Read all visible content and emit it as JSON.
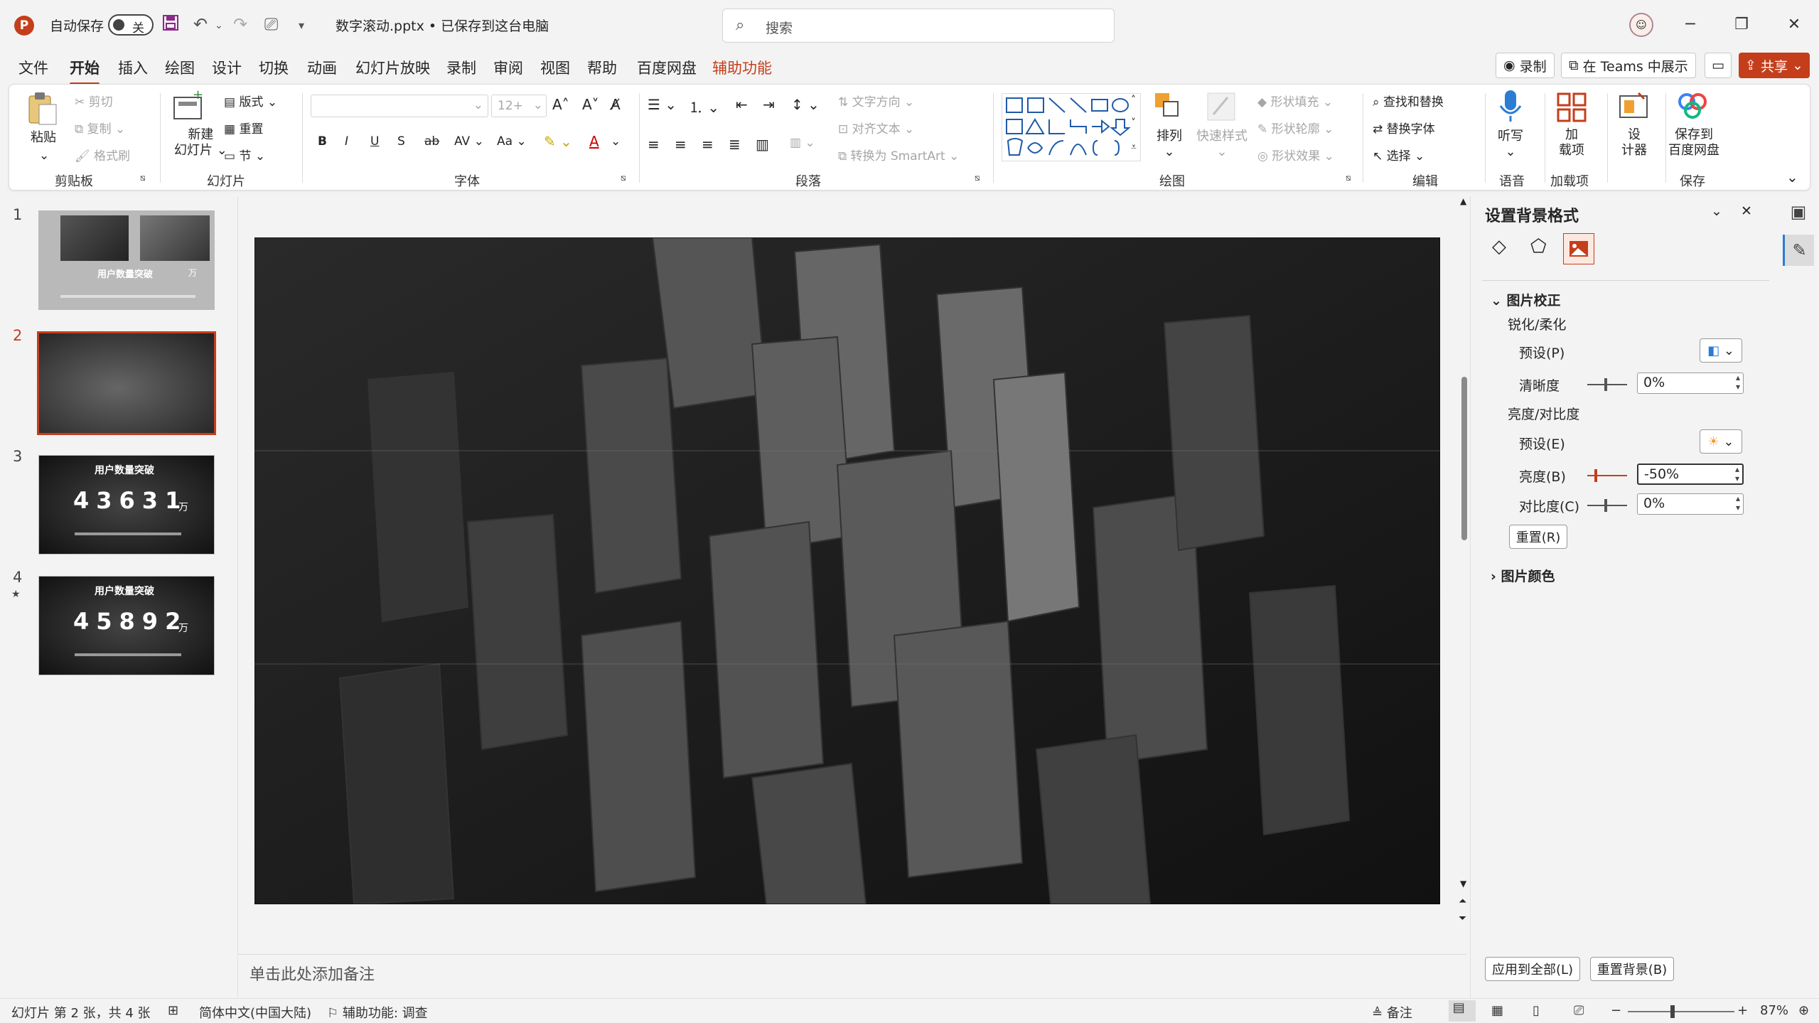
{
  "titlebar": {
    "autosave_label": "自动保存",
    "autosave_state": "关",
    "doc_title": "数字滚动.pptx • 已保存到这台电脑",
    "search_placeholder": "搜索",
    "logo": "P"
  },
  "menu": {
    "tabs": [
      "文件",
      "开始",
      "插入",
      "绘图",
      "设计",
      "切换",
      "动画",
      "幻灯片放映",
      "录制",
      "审阅",
      "视图",
      "帮助",
      "百度网盘",
      "辅助功能"
    ],
    "active": "开始",
    "record_label": "录制",
    "teams_label": "在 Teams 中展示",
    "share_label": "共享"
  },
  "ribbon": {
    "clipboard": {
      "paste": "粘贴",
      "cut": "剪切",
      "copy": "复制",
      "format_painter": "格式刷",
      "group": "剪贴板"
    },
    "slides": {
      "new_slide_line1": "新建",
      "new_slide_line2": "幻灯片",
      "layout": "版式",
      "reset": "重置",
      "section": "节",
      "group": "幻灯片"
    },
    "font": {
      "size": "12+",
      "group": "字体"
    },
    "paragraph": {
      "text_direction": "文字方向",
      "align_text": "对齐文本",
      "smartart": "转换为 SmartArt",
      "group": "段落"
    },
    "drawing": {
      "arrange": "排列",
      "quick_styles": "快速样式",
      "shape_fill": "形状填充",
      "shape_outline": "形状轮廓",
      "shape_effects": "形状效果",
      "group": "绘图"
    },
    "editing": {
      "find_replace": "查找和替换",
      "replace_font": "替换字体",
      "select": "选择",
      "group": "编辑"
    },
    "voice": {
      "dictate": "听写",
      "group": "语音"
    },
    "addins": {
      "addins_line1": "加",
      "addins_line2": "载项",
      "group": "加载项"
    },
    "designer": {
      "line1": "设",
      "line2": "计器"
    },
    "save": {
      "line1": "保存到",
      "line2": "百度网盘",
      "group": "保存"
    }
  },
  "thumbnails": [
    {
      "num": "1",
      "title": "用户数量突破",
      "unit": "万",
      "digits": ""
    },
    {
      "num": "2",
      "title": "",
      "unit": "",
      "digits": ""
    },
    {
      "num": "3",
      "title": "用户数量突破",
      "unit": "万",
      "digits": "43631"
    },
    {
      "num": "4",
      "title": "用户数量突破",
      "unit": "万",
      "digits": "45892",
      "star": "★"
    }
  ],
  "notes_placeholder": "单击此处添加备注",
  "pane": {
    "title": "设置背景格式",
    "section1": "图片校正",
    "sharpen_soften": "锐化/柔化",
    "preset_p": "预设(P)",
    "sharpness": "清晰度",
    "sharpness_value": "0%",
    "brightness_contrast": "亮度/对比度",
    "preset_e": "预设(E)",
    "brightness": "亮度(B)",
    "brightness_value": "-50%",
    "contrast": "对比度(C)",
    "contrast_value": "0%",
    "reset": "重置(R)",
    "section2": "图片颜色",
    "apply_all": "应用到全部(L)",
    "reset_bg": "重置背景(B)"
  },
  "status": {
    "slide_info": "幻灯片 第 2 张，共 4 张",
    "language": "简体中文(中国大陆)",
    "accessibility": "辅助功能: 调查",
    "notes": "备注",
    "zoom": "87%"
  },
  "colors": {
    "accent": "#c43e1c",
    "ribbon_bg": "#ffffff",
    "app_bg": "#f3f3f3"
  }
}
